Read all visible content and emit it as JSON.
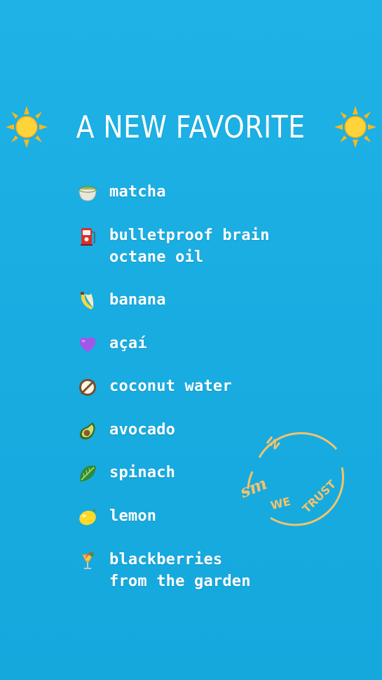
{
  "title": {
    "text": "A NEW FAVORITE",
    "left_icon": "sun-icon",
    "right_icon": "sun-icon"
  },
  "ingredients": [
    {
      "icon": "matcha-bowl-icon",
      "label": "matcha"
    },
    {
      "icon": "fuel-pump-icon",
      "label": "bulletproof brain\n octane oil"
    },
    {
      "icon": "banana-icon",
      "label": "banana"
    },
    {
      "icon": "purple-heart-icon",
      "label": "açaí"
    },
    {
      "icon": "coconut-icon",
      "label": "coconut water"
    },
    {
      "icon": "avocado-icon",
      "label": "avocado"
    },
    {
      "icon": "leafy-green-icon",
      "label": "spinach"
    },
    {
      "icon": "lemon-icon",
      "label": "lemon"
    },
    {
      "icon": "tropical-drink-icon",
      "label": "blackberries\n from the garden"
    }
  ],
  "stamp": {
    "icon": "circular-stamp",
    "top_text": "IN",
    "monogram": "sm",
    "bottom_text_1": "WE",
    "bottom_text_2": "TRUST",
    "color": "#f3c36c"
  },
  "colors": {
    "background": "#1aaee2",
    "text": "#ffffff",
    "stamp": "#f3c36c"
  }
}
